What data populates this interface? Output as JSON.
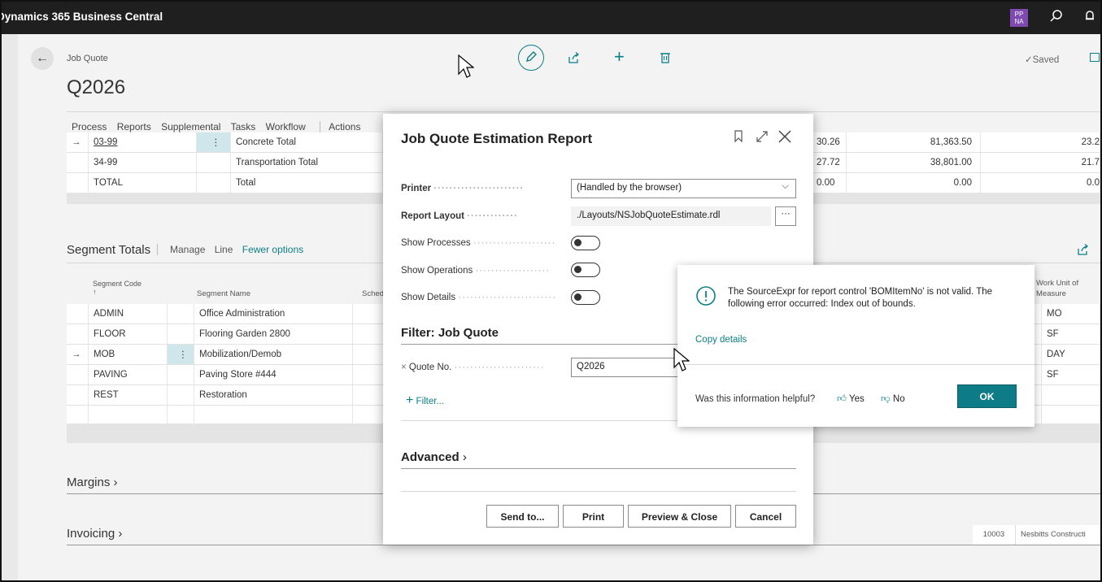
{
  "app": {
    "title": "Dynamics 365 Business Central",
    "avatar_initials_top": "PP",
    "avatar_initials_bottom": "NA"
  },
  "header": {
    "caption": "Job Quote",
    "record_no": "Q2026",
    "saved_label": "Saved"
  },
  "menu": [
    "Process",
    "Reports",
    "Supplemental",
    "Tasks",
    "Workflow",
    "Actions"
  ],
  "lines_table": {
    "rows": [
      {
        "code": "03-99",
        "desc": "Concrete Total",
        "a": "30.26",
        "b": "81,363.50",
        "c": "23.2"
      },
      {
        "code": "34-99",
        "desc": "Transportation Total",
        "a": "27.72",
        "b": "38,801.00",
        "c": "21.7"
      },
      {
        "code": "TOTAL",
        "desc": "Total",
        "a": "0.00",
        "b": "0.00",
        "c": "0.0"
      }
    ]
  },
  "segment_totals": {
    "title": "Segment Totals",
    "actions": [
      "Manage",
      "Line",
      "Fewer options"
    ],
    "col_code": "Segment Code",
    "col_code_sort": "↑",
    "col_name": "Segment Name",
    "col_sched": "Sched",
    "col_unit_1": "Work Unit of",
    "col_unit_2": "Measure",
    "rows": [
      {
        "code": "ADMIN",
        "name": "Office Administration",
        "unit": "MO"
      },
      {
        "code": "FLOOR",
        "name": "Flooring Garden 2800",
        "unit": "SF"
      },
      {
        "code": "MOB",
        "name": "Mobilization/Demob",
        "unit": "DAY"
      },
      {
        "code": "PAVING",
        "name": "Paving Store #444",
        "unit": "SF"
      },
      {
        "code": "REST",
        "name": "Restoration",
        "unit": ""
      }
    ]
  },
  "margins_label": "Margins",
  "invoicing_label": "Invoicing",
  "invoicing_cell_1": "10003",
  "invoicing_cell_2": "Nesbitts Constructi",
  "dialog": {
    "title": "Job Quote Estimation Report",
    "printer_label": "Printer",
    "printer_value": "(Handled by the browser)",
    "layout_label": "Report Layout",
    "layout_value": "./Layouts/NSJobQuoteEstimate.rdl",
    "show_processes": "Show Processes",
    "show_operations": "Show Operations",
    "show_details": "Show Details",
    "filter_title": "Filter: Job Quote",
    "quote_no_label": "Quote No.",
    "quote_no_value": "Q2026",
    "add_filter": "Filter...",
    "advanced": "Advanced",
    "buttons": {
      "send": "Send to...",
      "print": "Print",
      "preview": "Preview & Close",
      "cancel": "Cancel"
    }
  },
  "error": {
    "message": "The SourceExpr for report control 'BOMItemNo' is not valid. The following error occurred: Index out of bounds.",
    "copy": "Copy details",
    "helpful": "Was this information helpful?",
    "yes": "Yes",
    "no": "No",
    "ok": "OK"
  }
}
